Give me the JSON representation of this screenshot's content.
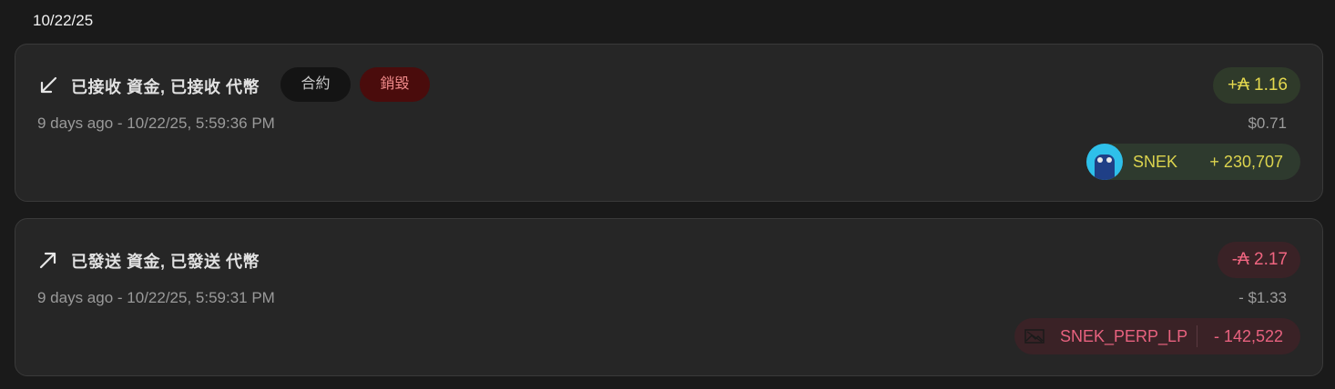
{
  "date_header": "10/22/25",
  "transactions": [
    {
      "direction": "received",
      "direction_icon": "arrow-down-left-icon",
      "title": "已接收 資金, 已接收 代幣",
      "badges": [
        "合約",
        "銷毀"
      ],
      "timestamp": "9 days ago - 10/22/25, 5:59:36 PM",
      "ada_amount": "+₳ 1.16",
      "fiat_amount": "$0.71",
      "token": {
        "icon": "snek-token-avatar",
        "name": "SNEK",
        "amount": "+ 230,707"
      },
      "color": "#e4d84e"
    },
    {
      "direction": "sent",
      "direction_icon": "arrow-up-right-icon",
      "title": "已發送 資金, 已發送 代幣",
      "badges": [],
      "timestamp": "9 days ago - 10/22/25, 5:59:31 PM",
      "ada_amount": "-₳ 2.17",
      "fiat_amount": "- $1.33",
      "token": {
        "icon": "broken-image-icon",
        "name": "SNEK_PERP_LP",
        "amount": "- 142,522"
      },
      "color": "#f06580"
    }
  ]
}
